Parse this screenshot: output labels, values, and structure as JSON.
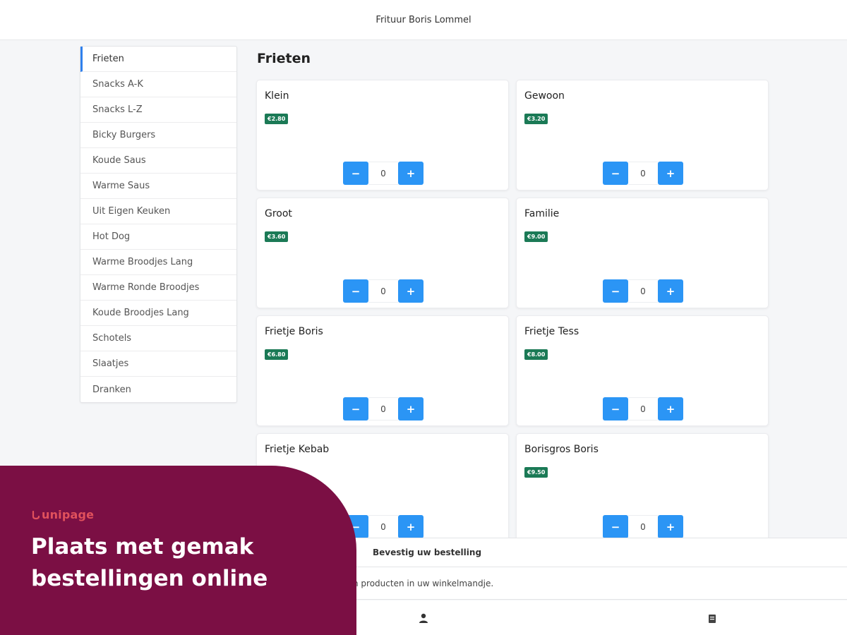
{
  "header": {
    "title": "Frituur Boris Lommel"
  },
  "sidebar": {
    "items": [
      {
        "label": "Frieten",
        "active": true
      },
      {
        "label": "Snacks A-K"
      },
      {
        "label": "Snacks L-Z"
      },
      {
        "label": "Bicky Burgers"
      },
      {
        "label": "Koude Saus"
      },
      {
        "label": "Warme Saus"
      },
      {
        "label": "Uit Eigen Keuken"
      },
      {
        "label": "Hot Dog"
      },
      {
        "label": "Warme Broodjes Lang"
      },
      {
        "label": "Warme Ronde Broodjes"
      },
      {
        "label": "Koude Broodjes Lang"
      },
      {
        "label": "Schotels"
      },
      {
        "label": "Slaatjes"
      },
      {
        "label": "Dranken"
      }
    ]
  },
  "main": {
    "title": "Frieten",
    "minus_label": "−",
    "plus_label": "+",
    "products": [
      {
        "name": "Klein",
        "price": "€2.80",
        "qty": "0"
      },
      {
        "name": "Gewoon",
        "price": "€3.20",
        "qty": "0"
      },
      {
        "name": "Groot",
        "price": "€3.60",
        "qty": "0"
      },
      {
        "name": "Familie",
        "price": "€9.00",
        "qty": "0"
      },
      {
        "name": "Frietje Boris",
        "price": "€6.80",
        "qty": "0"
      },
      {
        "name": "Frietje Tess",
        "price": "€8.00",
        "qty": "0"
      },
      {
        "name": "Frietje Kebab",
        "price": "",
        "qty": "0"
      },
      {
        "name": "Borisgros Boris",
        "price": "€9.50",
        "qty": "0"
      }
    ]
  },
  "cart": {
    "header": "Bevestig uw bestelling",
    "message": "n producten in uw winkelmandje."
  },
  "promo": {
    "brand": "unipage",
    "headline_line1": "Plaats met gemak",
    "headline_line2": "bestellingen online"
  },
  "colors": {
    "accent_blue": "#2b95f5",
    "price_green": "#1b7a56",
    "promo_bg": "#7b0f44",
    "brand_red": "#e1515c"
  },
  "icons": {
    "user": "user-icon",
    "cart": "cart-icon"
  }
}
